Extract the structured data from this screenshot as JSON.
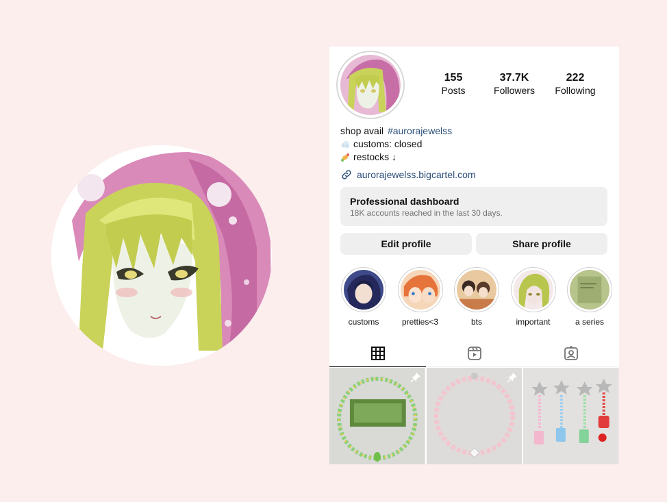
{
  "profile": {
    "stats": [
      {
        "value": "155",
        "label": "Posts"
      },
      {
        "value": "37.7K",
        "label": "Followers"
      },
      {
        "value": "222",
        "label": "Following"
      }
    ],
    "bio": {
      "line1_prefix": "shop avail ",
      "line1_tag": "#aurorajewelss",
      "line2": "customs: closed",
      "line3": "restocks ↓"
    },
    "link": "aurorajewelss.bigcartel.com"
  },
  "dashboard": {
    "title": "Professional dashboard",
    "subtitle": "18K accounts reached in the last 30 days."
  },
  "buttons": {
    "edit": "Edit profile",
    "share": "Share profile"
  },
  "highlights": [
    "customs",
    "pretties<3",
    "bts",
    "important",
    "a series"
  ],
  "tabs": [
    {
      "icon": "grid-icon"
    },
    {
      "icon": "reels-icon"
    },
    {
      "icon": "tagged-icon"
    }
  ],
  "posts": [
    {
      "pinned": true
    },
    {
      "pinned": true
    },
    {
      "pinned": false
    }
  ],
  "colors": {
    "background": "#fbeeed",
    "link": "#2b4f7a",
    "button": "#efefef",
    "secondary_text": "#737373"
  }
}
